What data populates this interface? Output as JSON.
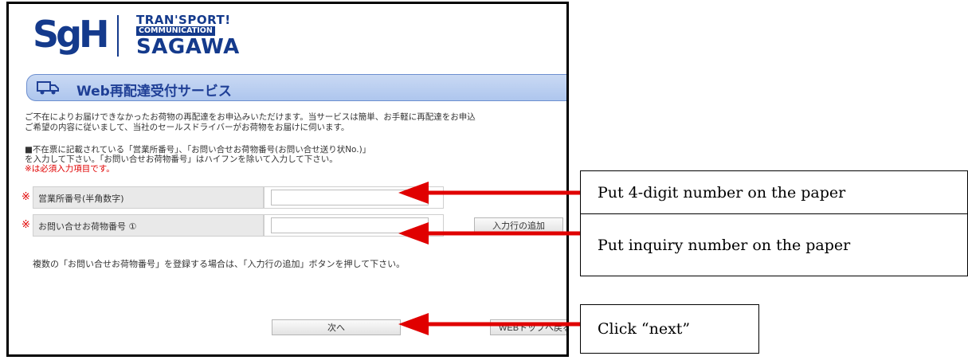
{
  "logo": {
    "mark": "SgH",
    "line1": "TRAN'SPORT!",
    "line2": "COMMUNICATION",
    "line3": "SAGAWA"
  },
  "page": {
    "title": "Web再配達受付サービス",
    "intro_line1": "ご不在によりお届けできなかったお荷物の再配達をお申込みいただけます。当サービスは簡単、お手軽に再配達をお申込",
    "intro_line2": "ご希望の内容に従いまして、当社のセールスドライバーがお荷物をお届けに伺います。",
    "note_line1": "■不在票に記載されている「営業所番号」、「お問い合せお荷物番号(お問い合せ送り状No.)」",
    "note_line2": "を入力して下さい。「お問い合せお荷物番号」はハイフンを除いて入力して下さい。",
    "note_required": "※は必須入力項目です。",
    "form": {
      "required_mark": "※",
      "office_label": "営業所番号(半角数字)",
      "inquiry_label": "お問い合せお荷物番号 ①",
      "office_value": "",
      "inquiry_value": "",
      "add_row_label": "入力行の追加"
    },
    "multi_note": "複数の「お問い合せお荷物番号」を登録する場合は、「入力行の追加」ボタンを押して下さい。",
    "next_label": "次へ",
    "partial_button_label": "WEBトップへ戻る"
  },
  "annotations": {
    "a1": "Put 4-digit number on the paper",
    "a2": "Put inquiry number on the paper",
    "a3": "Click “next”"
  },
  "colors": {
    "brand": "#143a8c",
    "arrow": "#e00000",
    "required": "#e00000"
  }
}
